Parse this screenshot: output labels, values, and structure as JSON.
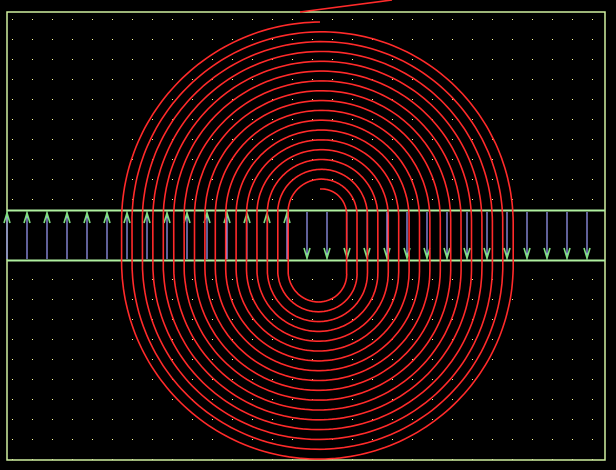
{
  "colors": {
    "background": "#000000",
    "border": "#d0f0a0",
    "strip_outline": "#b0f0a0",
    "current_line": "#a0a0ff",
    "arrowhead": "#80e080",
    "field_dot": "#ffff99",
    "spiral": "#ff2a2a"
  },
  "icons": {
    "field_vector": "dot-marker",
    "current_arrow": "arrow-glyph"
  },
  "strip": {
    "left_half_direction": "up",
    "right_half_direction": "down"
  },
  "spiral": {
    "turns": 17,
    "direction": "outward"
  }
}
